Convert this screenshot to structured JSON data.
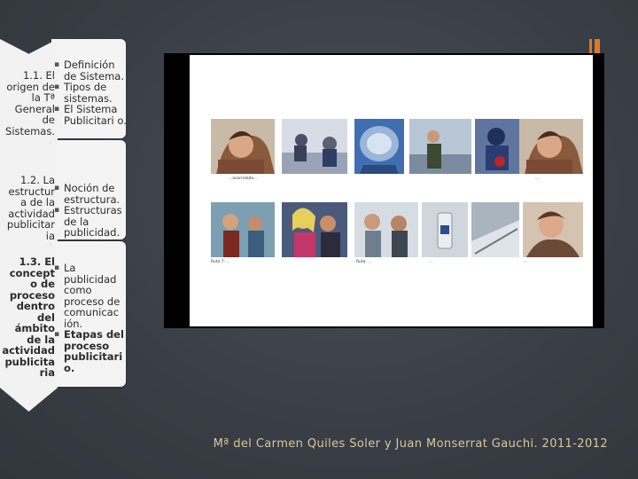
{
  "sections": [
    {
      "title": "1.1. El origen de la Tª General de Sistemas.",
      "bullets": [
        "Definición de Sistema.",
        "Tipos de sistemas.",
        "El Sistema Publicitari o."
      ]
    },
    {
      "title": "1.2. La estructur a de la actividad publicitar ia",
      "bullets": [
        "Noción de estructura.",
        "Estructuras de la publicidad."
      ]
    },
    {
      "title": "1.3. El concept o de proceso dentro del ámbito de la actividad publicita ria",
      "bullets": [
        "La publicidad como proceso de comunicac ión.",
        "Etapas del proceso publicitari o."
      ]
    }
  ],
  "comic": {
    "captions": [
      "...acorralado...",
      "...",
      "Ruta: ...",
      "...",
      "Ruta 7: ...",
      "..."
    ]
  },
  "footer": "Mª del Carmen Quiles Soler y Juan Monserrat Gauchi. 2011-2012",
  "colors": {
    "accent": "#e07a1f",
    "background": "#3a3f47",
    "footer_text": "#d9c79a"
  }
}
